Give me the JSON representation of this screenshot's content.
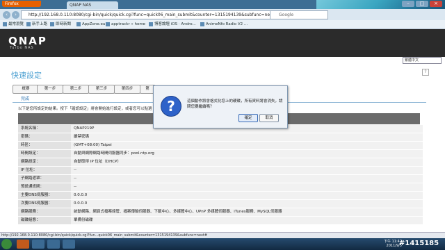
{
  "browser": {
    "menu_button": "Firefox",
    "tab_title": "QNAP NAS",
    "url": "http://192.168.0.110:8080/cgi-bin/quick/quick.cgi?func=quick06_main_submit&counter=1315194139&subfunc=next",
    "search_placeholder": "Google",
    "bookmarks": [
      "最常瀏覽",
      "新手上路",
      "即時新聞",
      "AppZone.eu",
      "apptrackr » home",
      "博客論壇 iOS · Andro...",
      "AnimeNfo Radio V2 ..."
    ]
  },
  "qnap": {
    "logo": "QNAP",
    "logo_sub": "Turbo NAS",
    "language": "繁體中文",
    "page_title": "快速設定",
    "steps": [
      "概要",
      "第一步",
      "第二步",
      "第三步",
      "第四步",
      "第"
    ],
    "section_title": "完成",
    "intro": "以下是您所設定的結果。按下「確認設定」將會開始進行設定，或者您可以點選"
  },
  "settings_rows": [
    {
      "key": "系統名稱：",
      "value": "QNAP219P"
    },
    {
      "key": "密碼：",
      "value": "嚴禁密碼"
    },
    {
      "key": "時區：",
      "value": "(GMT+08:00) Taipei"
    },
    {
      "key": "時間設定：",
      "value": "自動與網際網路時間伺服器同步：pool.ntp.org"
    },
    {
      "key": "網路設定：",
      "value": "自動取得 IP 位址（DHCP）"
    },
    {
      "key": "IP 位址：",
      "value": "--"
    },
    {
      "key": "子網路遮罩：",
      "value": "--"
    },
    {
      "key": "預設通訊閘：",
      "value": "--"
    },
    {
      "key": "主要DNS伺服器：",
      "value": "0.0.0.0"
    },
    {
      "key": "次要DNS伺服器：",
      "value": "0.0.0.0"
    },
    {
      "key": "網路服務：",
      "value": "啟動網路、網頁式檔案總管、檔案傳輸伺服器、下載中心、多媒體中心、UPnP 多媒體伺服器、iTunes服務、MySQL伺服器"
    },
    {
      "key": "磁碟組態：",
      "value": "單備份磁碟"
    }
  ],
  "dialog": {
    "message": "這個動作將會格式化您上的硬碟，所有資料將會消失，請問您要繼續嗎？",
    "ok_label": "確定",
    "cancel_label": "取消"
  },
  "statusbar": "http://192.168.0.110:8080/cgi-bin/quick/quick.cgi?fun...quick06_main_submit&counter=1315194139&subfunc=next#",
  "taskbar": {
    "clock_time": "下午 11:42",
    "clock_date": "2011/9/5"
  },
  "watermark": "#1415185"
}
